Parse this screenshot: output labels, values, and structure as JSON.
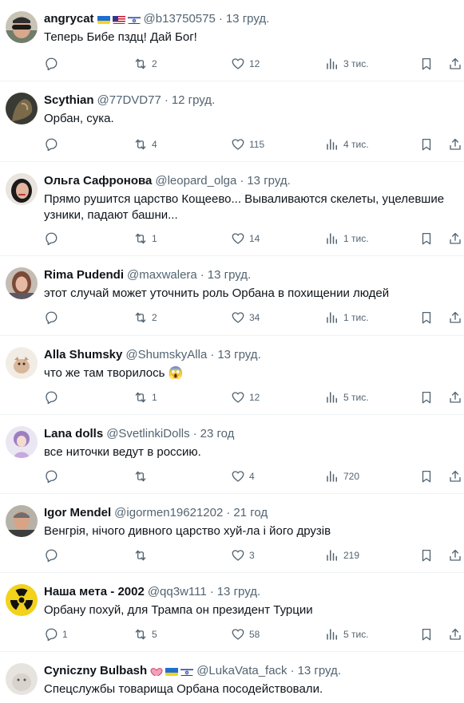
{
  "replies": [
    {
      "name": "angrycat",
      "flags": [
        "ua",
        "us",
        "il"
      ],
      "handle": "@b13750575",
      "dot": "·",
      "time": "13 груд.",
      "text": "Теперь Бибе пздц! Дай Бог!",
      "reply_count": "",
      "retweet_count": "2",
      "like_count": "12",
      "view_count": "3 тис."
    },
    {
      "name": "Scythian",
      "flags": [],
      "handle": "@77DVD77",
      "dot": "·",
      "time": "12 груд.",
      "text": "Орбан, сука.",
      "reply_count": "",
      "retweet_count": "4",
      "like_count": "115",
      "view_count": "4 тис."
    },
    {
      "name": "Ольга Сафронова",
      "flags": [],
      "handle": "@leopard_olga",
      "dot": "·",
      "time": "13 груд.",
      "text": "Прямо рушится царство Кощеево... Вываливаются скелеты, уцелевшие узники, падают башни...",
      "reply_count": "",
      "retweet_count": "1",
      "like_count": "14",
      "view_count": "1 тис."
    },
    {
      "name": "Rima Pudendi",
      "flags": [],
      "handle": "@maxwalera",
      "dot": "·",
      "time": "13 груд.",
      "text": "этот случай может уточнить роль Орбана в похищении людей",
      "reply_count": "",
      "retweet_count": "2",
      "like_count": "34",
      "view_count": "1 тис."
    },
    {
      "name": "Alla Shumsky",
      "flags": [],
      "handle": "@ShumskyAlla",
      "dot": "·",
      "time": "13 груд.",
      "text": "что же там творилось 😱",
      "reply_count": "",
      "retweet_count": "1",
      "like_count": "12",
      "view_count": "5 тис."
    },
    {
      "name": "Lana dolls",
      "flags": [],
      "handle": "@SvetlinkiDolls",
      "dot": "·",
      "time": "23 год",
      "text": "все ниточки ведут в россию.",
      "reply_count": "",
      "retweet_count": "",
      "like_count": "4",
      "view_count": "720"
    },
    {
      "name": "Igor Mendel",
      "flags": [],
      "handle": "@igormen19621202",
      "dot": "·",
      "time": "21 год",
      "text": "Венгрія, нічого дивного царство хуй-ла і його друзів",
      "reply_count": "",
      "retweet_count": "",
      "like_count": "3",
      "view_count": "219"
    },
    {
      "name": "Наша мета - 2002",
      "flags": [],
      "handle": "@qq3w111",
      "dot": "·",
      "time": "13 груд.",
      "text": "Орбану похуй, для Трампа он президент Турции",
      "reply_count": "1",
      "retweet_count": "5",
      "like_count": "58",
      "view_count": "5 тис."
    },
    {
      "name": "Cyniczny Bulbash",
      "flags": [
        "heart",
        "ua",
        "il"
      ],
      "handle": "@LukaVata_fack",
      "dot": "·",
      "time": "13 груд.",
      "text": "Спецслужбы товарища Орбана посодействовали.",
      "reply_count": "",
      "retweet_count": "",
      "like_count": "",
      "view_count": ""
    }
  ],
  "icons": {
    "reply": "reply-icon",
    "retweet": "retweet-icon",
    "like": "heart-icon",
    "views": "views-icon",
    "bookmark": "bookmark-icon",
    "share": "share-icon"
  },
  "colors": {
    "text": "#0f1419",
    "secondary": "#536471",
    "divider": "#eff3f4"
  }
}
